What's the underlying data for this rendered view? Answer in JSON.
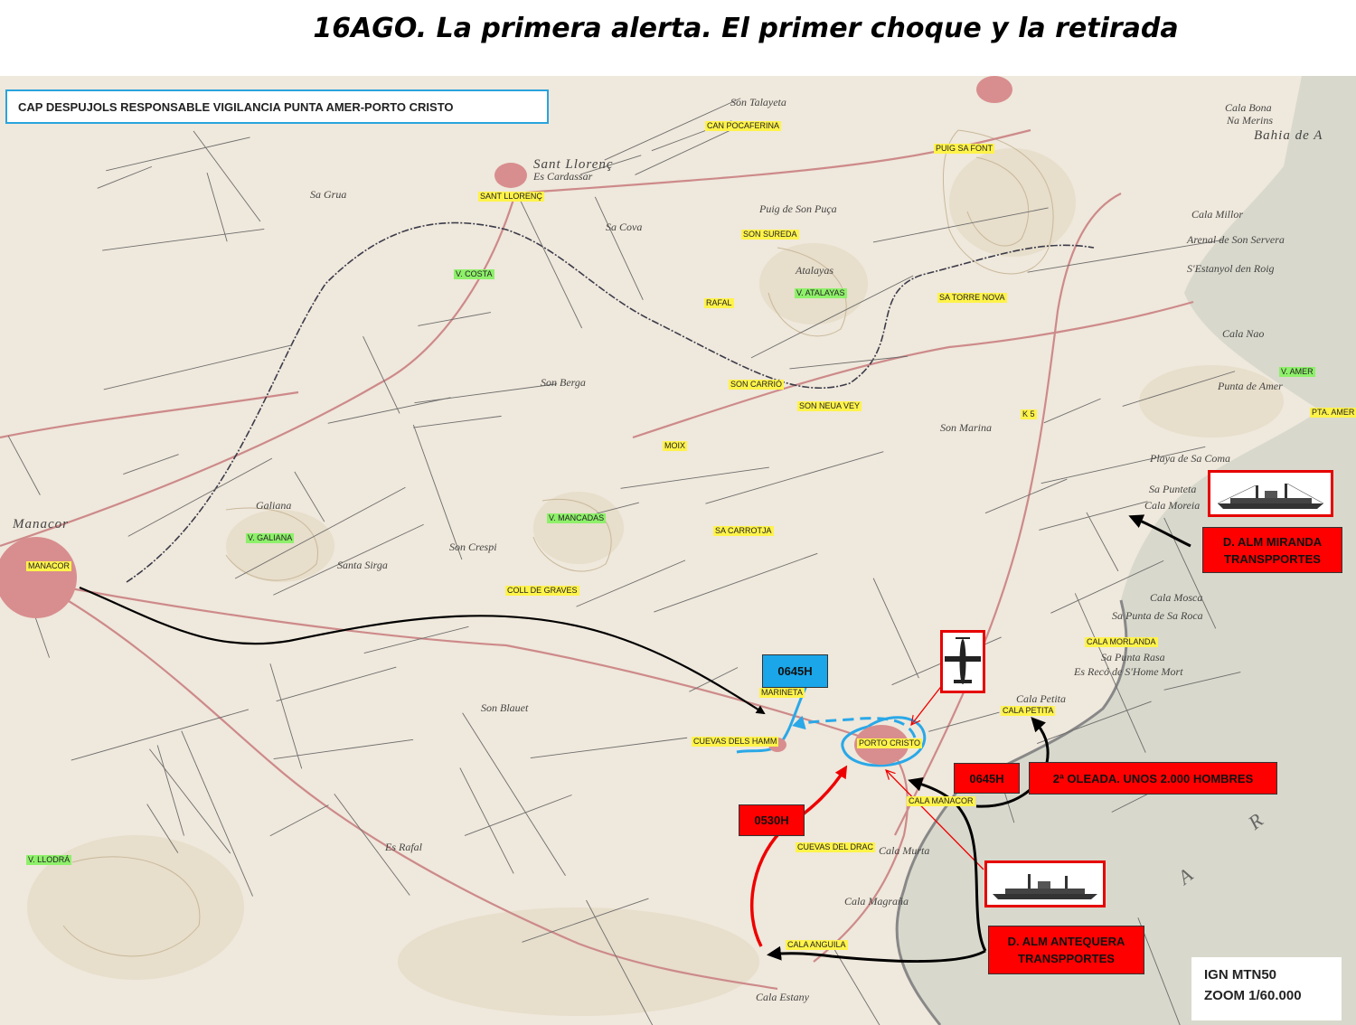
{
  "title": "16AGO. La primera alerta. El primer choque y la retirada",
  "note": "CAP DESPUJOLS RESPONSABLE VIGILANCIA PUNTA AMER-PORTO CRISTO",
  "ign": {
    "line1": "IGN MTN50",
    "line2": "ZOOM 1/60.000"
  },
  "labels": {
    "manacor": "MANACOR",
    "sant_llorenc": "SANT LLORENÇ",
    "can_pocaferina": "CAN POCAFERINA",
    "puig_sa_font": "PUIG SA FONT",
    "son_sureda": "SON SUREDA",
    "v_costa": "V. COSTA",
    "v_atalayas": "V. ATALAYAS",
    "rafal": "RAFAL",
    "sa_torre_nova": "SA TORRE NOVA",
    "son_carrio": "SON CARRIÓ",
    "son_neua_vey": "SON NEUA VEY",
    "moix": "MOIX",
    "v_amer": "V. AMER",
    "pta_amer": "PTA. AMER",
    "k5": "K 5",
    "v_galiana": "V. GALIANA",
    "v_mancadas": "V. MANCADAS",
    "sa_carrotja": "SA CARROTJA",
    "coll_de_graves": "COLL DE GRAVES",
    "marineta": "MARINETA",
    "cuevas_hamm": "CUEVAS DELS HAMM",
    "porto_cristo": "PORTO CRISTO",
    "cala_morlanda": "CALA MORLANDA",
    "cala_petita": "CALA PETITA",
    "cala_manacor": "CALA MANACOR",
    "cuevas_drac": "CUEVAS DEL DRAC",
    "cala_anguila": "CALA ANGUILA",
    "v_llodra": "V. LLODRÁ"
  },
  "places": {
    "manacor": "Manacor",
    "sant_llorenc": "Sant Llorenç",
    "es_cardassar": "Es Cardassar",
    "bahia": "Bahia de A",
    "cala_bona": "Cala Bona",
    "na_merins": "Na Merins",
    "cala_millor": "Cala Millor",
    "arenal": "Arenal de Son Servera",
    "estanyol": "S'Estanyol den Roig",
    "cala_nao": "Cala Nao",
    "punta_amer": "Punta de Amer",
    "playa_sa_coma": "Playa de Sa Coma",
    "sa_punteta": "Sa Punteta",
    "cala_moreia": "Cala Moreia",
    "cala_mosca": "Cala Mosca",
    "punta_sa_roca": "Sa Punta de Sa Roca",
    "punta_rasa": "Sa Punta Rasa",
    "es_reco": "Es Recó de S'Home Mort",
    "cala_petita": "Cala Petita",
    "cala_murta": "Cala Murta",
    "cala_magrana": "Cala Magraña",
    "cala_estany": "Cala Estany",
    "son_berga": "Son Berga",
    "son_marina": "Son Marina",
    "son_crespi": "Son Crespi",
    "santa_sirga": "Santa Sirga",
    "son_blauet": "Son Blauet",
    "es_rafal": "Es Rafal",
    "galiana": "Galiana",
    "atalayas": "Atalayas",
    "sa_grua": "Sa Grua",
    "sa_cova": "Sa Cova",
    "puig_son_puca": "Puig de Son Puça",
    "son_talayeta": "Son Talayeta",
    "mar": "A R"
  },
  "boxes": {
    "miranda": "D. ALM MIRANDA\nTRANSPPORTES",
    "antequera": "D. ALM ANTEQUERA\nTRANSPPORTES",
    "time_0645_blue": "0645H",
    "time_0645_red": "0645H",
    "time_0530": "0530H",
    "oleada": "2ª OLEADA. UNOS 2.000 HOMBRES"
  },
  "colors": {
    "accent_red": "#ff0000",
    "accent_blue": "#1aa6e8",
    "sea": "#d8d8cc",
    "land": "#efe8dc",
    "roads": "#c87c7c",
    "paths": "#555555"
  }
}
